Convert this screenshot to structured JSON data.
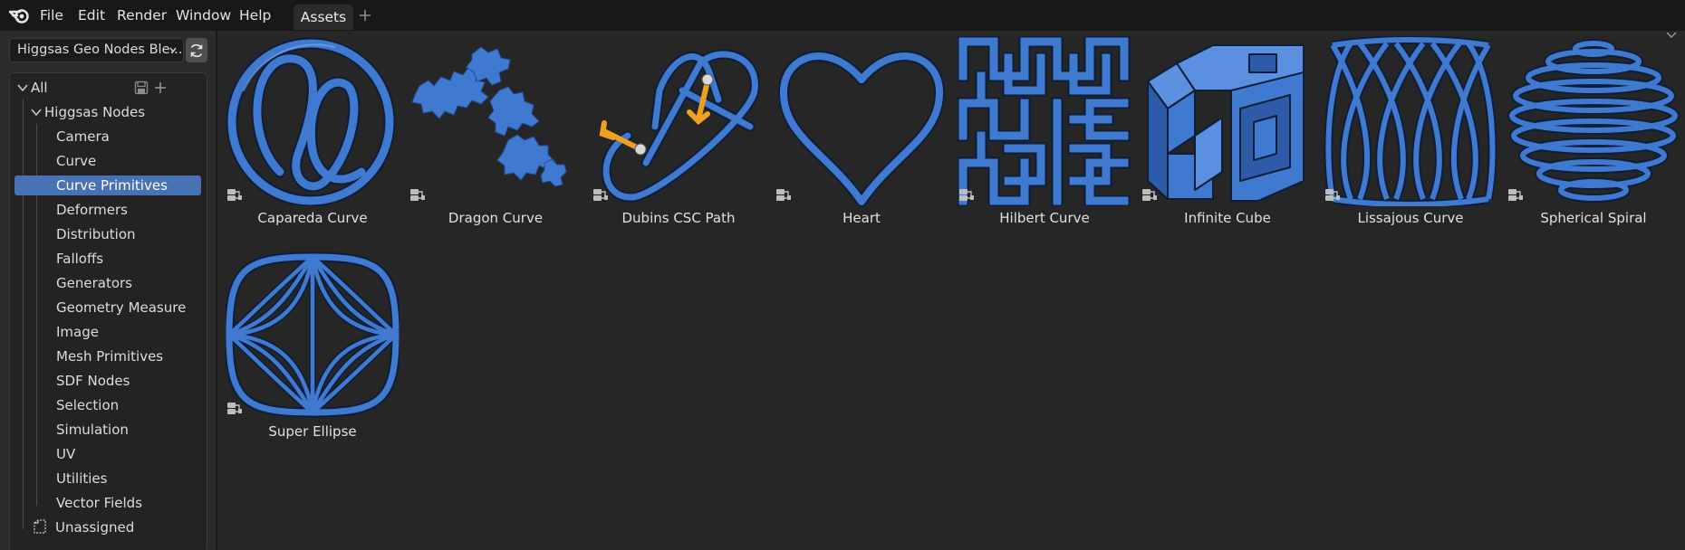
{
  "app": {
    "logo_icon": "blender-logo-icon",
    "menu": [
      "File",
      "Edit",
      "Render",
      "Window",
      "Help"
    ],
    "workspace_tabs": [
      {
        "label": "Assets",
        "active": true
      }
    ],
    "add_tab_icon": "plus-icon"
  },
  "sidebar": {
    "library_selector": {
      "value": "Higgsas Geo Nodes Ble...",
      "icon": "chevron-down-icon"
    },
    "refresh_icon": "refresh-icon",
    "tree": {
      "root": {
        "label": "All",
        "expanded": true,
        "save_icon": "save-icon",
        "add_icon": "plus-icon"
      },
      "group": {
        "label": "Higgsas Nodes",
        "expanded": true
      },
      "items": [
        {
          "label": "Camera"
        },
        {
          "label": "Curve"
        },
        {
          "label": "Curve Primitives",
          "selected": true
        },
        {
          "label": "Deformers"
        },
        {
          "label": "Distribution"
        },
        {
          "label": "Falloffs"
        },
        {
          "label": "Generators"
        },
        {
          "label": "Geometry Measure"
        },
        {
          "label": "Image"
        },
        {
          "label": "Mesh Primitives"
        },
        {
          "label": "SDF Nodes"
        },
        {
          "label": "Selection"
        },
        {
          "label": "Simulation"
        },
        {
          "label": "UV"
        },
        {
          "label": "Utilities"
        },
        {
          "label": "Vector Fields"
        }
      ],
      "unassigned": {
        "label": "Unassigned",
        "icon": "unassigned-icon"
      }
    }
  },
  "assets": {
    "accent_color": "#3f7ad0",
    "badge_icon": "node-group-asset-icon",
    "items": [
      {
        "name": "Capareda Curve"
      },
      {
        "name": "Dragon Curve"
      },
      {
        "name": "Dubins CSC Path"
      },
      {
        "name": "Heart"
      },
      {
        "name": "Hilbert Curve"
      },
      {
        "name": "Infinite Cube"
      },
      {
        "name": "Lissajous Curve"
      },
      {
        "name": "Spherical Spiral"
      },
      {
        "name": "Super Ellipse"
      }
    ]
  },
  "colors": {
    "selection": "#4772b3",
    "tube_blue": "#3f7ad0",
    "arrow_orange": "#f0a020"
  }
}
